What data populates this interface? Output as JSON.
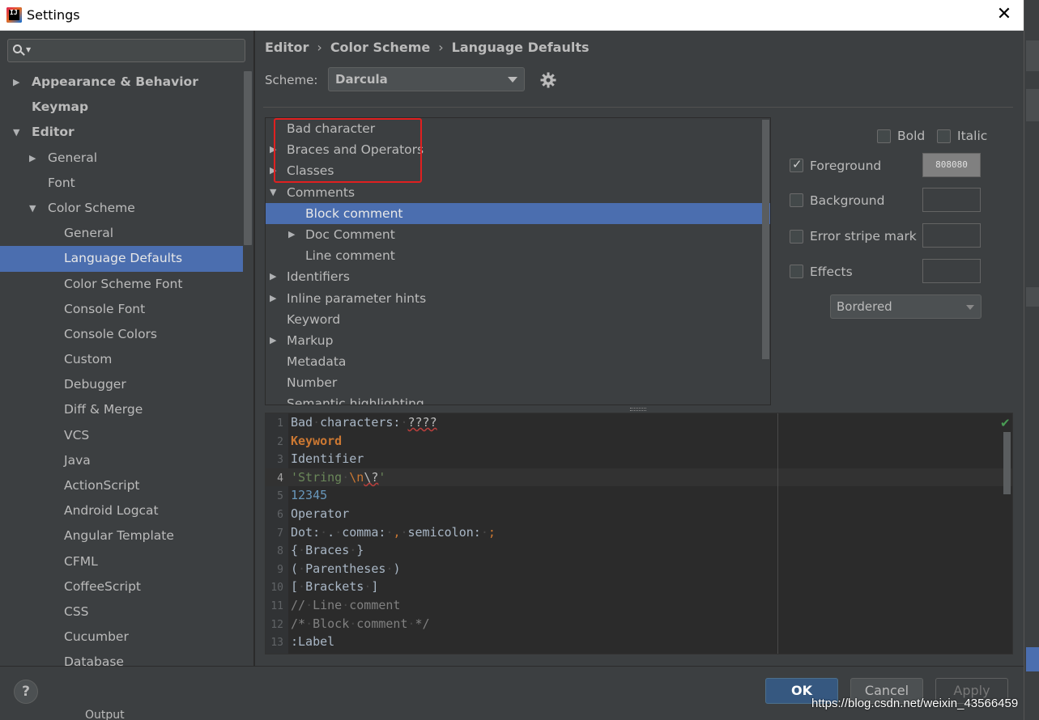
{
  "window": {
    "title": "Settings",
    "close_glyph": "✕",
    "app_icon": "intellij-icon",
    "app_icon_text": "IJ"
  },
  "search": {
    "value": "",
    "placeholder": ""
  },
  "sidebar": {
    "items": [
      {
        "label": "Appearance & Behavior",
        "level": 0,
        "bold": true,
        "arrow": "▶"
      },
      {
        "label": "Keymap",
        "level": 0,
        "bold": true,
        "arrow": ""
      },
      {
        "label": "Editor",
        "level": 0,
        "bold": true,
        "arrow": "▼"
      },
      {
        "label": "General",
        "level": 1,
        "arrow": "▶"
      },
      {
        "label": "Font",
        "level": 1,
        "arrow": ""
      },
      {
        "label": "Color Scheme",
        "level": 1,
        "arrow": "▼"
      },
      {
        "label": "General",
        "level": 2,
        "arrow": ""
      },
      {
        "label": "Language Defaults",
        "level": 2,
        "arrow": "",
        "selected": true
      },
      {
        "label": "Color Scheme Font",
        "level": 2,
        "arrow": ""
      },
      {
        "label": "Console Font",
        "level": 2,
        "arrow": ""
      },
      {
        "label": "Console Colors",
        "level": 2,
        "arrow": ""
      },
      {
        "label": "Custom",
        "level": 2,
        "arrow": ""
      },
      {
        "label": "Debugger",
        "level": 2,
        "arrow": ""
      },
      {
        "label": "Diff & Merge",
        "level": 2,
        "arrow": ""
      },
      {
        "label": "VCS",
        "level": 2,
        "arrow": ""
      },
      {
        "label": "Java",
        "level": 2,
        "arrow": ""
      },
      {
        "label": "ActionScript",
        "level": 2,
        "arrow": ""
      },
      {
        "label": "Android Logcat",
        "level": 2,
        "arrow": ""
      },
      {
        "label": "Angular Template",
        "level": 2,
        "arrow": ""
      },
      {
        "label": "CFML",
        "level": 2,
        "arrow": ""
      },
      {
        "label": "CoffeeScript",
        "level": 2,
        "arrow": ""
      },
      {
        "label": "CSS",
        "level": 2,
        "arrow": ""
      },
      {
        "label": "Cucumber",
        "level": 2,
        "arrow": ""
      },
      {
        "label": "Database",
        "level": 2,
        "arrow": ""
      }
    ]
  },
  "breadcrumb": [
    "Editor",
    "Color Scheme",
    "Language Defaults"
  ],
  "breadcrumb_sep": "›",
  "scheme": {
    "label": "Scheme:",
    "value": "Darcula"
  },
  "attributes": [
    {
      "label": "Bad character",
      "level": 0,
      "arrow": ""
    },
    {
      "label": "Braces and Operators",
      "level": 0,
      "arrow": "▶"
    },
    {
      "label": "Classes",
      "level": 0,
      "arrow": "▶"
    },
    {
      "label": "Comments",
      "level": 0,
      "arrow": "▼"
    },
    {
      "label": "Block comment",
      "level": 1,
      "arrow": "",
      "selected": true
    },
    {
      "label": "Doc Comment",
      "level": 1,
      "arrow": "▶"
    },
    {
      "label": "Line comment",
      "level": 1,
      "arrow": ""
    },
    {
      "label": "Identifiers",
      "level": 0,
      "arrow": "▶"
    },
    {
      "label": "Inline parameter hints",
      "level": 0,
      "arrow": "▶"
    },
    {
      "label": "Keyword",
      "level": 0,
      "arrow": ""
    },
    {
      "label": "Markup",
      "level": 0,
      "arrow": "▶"
    },
    {
      "label": "Metadata",
      "level": 0,
      "arrow": ""
    },
    {
      "label": "Number",
      "level": 0,
      "arrow": ""
    },
    {
      "label": "Semantic highlighting",
      "level": 0,
      "arrow": ""
    }
  ],
  "options": {
    "bold": {
      "label": "Bold",
      "checked": false
    },
    "italic": {
      "label": "Italic",
      "checked": false
    },
    "foreground": {
      "label": "Foreground",
      "checked": true,
      "color": "808080"
    },
    "background": {
      "label": "Background",
      "checked": false
    },
    "error_stripe": {
      "label": "Error stripe mark",
      "checked": false
    },
    "effects": {
      "label": "Effects",
      "checked": false,
      "style": "Bordered"
    }
  },
  "preview": {
    "lines": [
      {
        "n": "1",
        "parts": [
          [
            "def",
            "Bad"
          ],
          [
            "ws",
            "·"
          ],
          [
            "def",
            "characters:"
          ],
          [
            "ws",
            "·"
          ],
          [
            "bad",
            "????"
          ]
        ]
      },
      {
        "n": "2",
        "parts": [
          [
            "kw",
            "Keyword"
          ]
        ]
      },
      {
        "n": "3",
        "parts": [
          [
            "def",
            "Identifier"
          ]
        ]
      },
      {
        "n": "4",
        "current": true,
        "parts": [
          [
            "str",
            "'String"
          ],
          [
            "ws",
            "·"
          ],
          [
            "esc",
            "\\n"
          ],
          [
            "bad",
            "\\?"
          ],
          [
            "str",
            "'"
          ]
        ]
      },
      {
        "n": "5",
        "parts": [
          [
            "num",
            "12345"
          ]
        ]
      },
      {
        "n": "6",
        "parts": [
          [
            "def",
            "Operator"
          ]
        ]
      },
      {
        "n": "7",
        "parts": [
          [
            "def",
            "Dot:"
          ],
          [
            "ws",
            "·"
          ],
          [
            "def",
            "."
          ],
          [
            "ws",
            "·"
          ],
          [
            "def",
            "comma:"
          ],
          [
            "ws",
            "·"
          ],
          [
            "semi",
            ","
          ],
          [
            "ws",
            "·"
          ],
          [
            "def",
            "semicolon:"
          ],
          [
            "ws",
            "·"
          ],
          [
            "semi",
            ";"
          ]
        ]
      },
      {
        "n": "8",
        "parts": [
          [
            "def",
            "{"
          ],
          [
            "ws",
            "·"
          ],
          [
            "def",
            "Braces"
          ],
          [
            "ws",
            "·"
          ],
          [
            "def",
            "}"
          ]
        ]
      },
      {
        "n": "9",
        "parts": [
          [
            "def",
            "("
          ],
          [
            "ws",
            "·"
          ],
          [
            "def",
            "Parentheses"
          ],
          [
            "ws",
            "·"
          ],
          [
            "def",
            ")"
          ]
        ]
      },
      {
        "n": "10",
        "parts": [
          [
            "def",
            "["
          ],
          [
            "ws",
            "·"
          ],
          [
            "def",
            "Brackets"
          ],
          [
            "ws",
            "·"
          ],
          [
            "def",
            "]"
          ]
        ]
      },
      {
        "n": "11",
        "parts": [
          [
            "cm",
            "//"
          ],
          [
            "ws",
            "·"
          ],
          [
            "cm",
            "Line"
          ],
          [
            "ws",
            "·"
          ],
          [
            "cm",
            "comment"
          ]
        ]
      },
      {
        "n": "12",
        "parts": [
          [
            "cm",
            "/*"
          ],
          [
            "ws",
            "·"
          ],
          [
            "cm",
            "Block"
          ],
          [
            "ws",
            "·"
          ],
          [
            "cm",
            "comment"
          ],
          [
            "ws",
            "·"
          ],
          [
            "cm",
            "*/"
          ]
        ]
      },
      {
        "n": "13",
        "parts": [
          [
            "def",
            ":Label"
          ]
        ]
      }
    ]
  },
  "buttons": {
    "help": "?",
    "ok": "OK",
    "cancel": "Cancel",
    "apply": "Apply"
  },
  "behind_text": "Output",
  "watermark": "https://blog.csdn.net/weixin_43566459",
  "colors": {
    "selection": "#4b6eaf",
    "accent_ok": "#365880",
    "highlight_box": "#e02020"
  }
}
